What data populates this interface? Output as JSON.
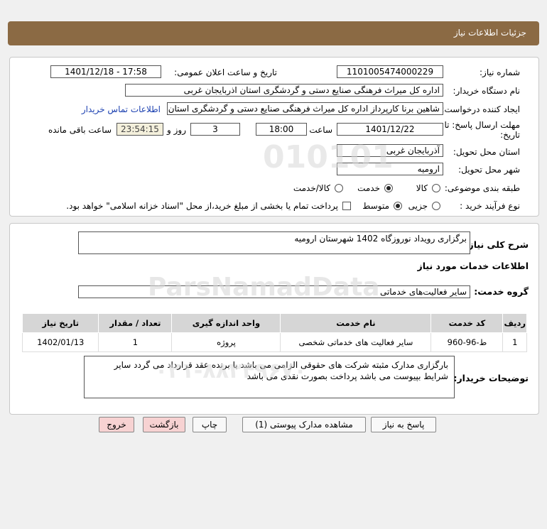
{
  "header": {
    "title": "جزئیات اطلاعات نیاز"
  },
  "form": {
    "need_number_label": "شماره نیاز:",
    "need_number": "1101005474000229",
    "announce_label": "تاریخ و ساعت اعلان عمومی:",
    "announce_value": "1401/12/18 - 17:58",
    "buyer_org_label": "نام دستگاه خریدار:",
    "buyer_org": "اداره کل میراث فرهنگی  صنایع دستی و گردشگری استان اذربایجان غربی",
    "requester_label": "ایجاد کننده درخواست:",
    "requester": "شاهین برنا کارپرداز اداره کل میراث فرهنگی  صنایع دستی و گردشگری استان اذربایجان غربی",
    "contact_link": "اطلاعات تماس خریدار",
    "deadline_label_1": "مهلت ارسال پاسخ: تا",
    "deadline_label_2": "تاریخ:",
    "deadline_date": "1401/12/22",
    "time_label": "ساعت",
    "deadline_time": "18:00",
    "days_value": "3",
    "days_label": "روز و",
    "remaining_time": "23:54:15",
    "remaining_label": "ساعت باقی مانده",
    "province_label": "استان محل تحویل:",
    "province": "آذربایجان غربی",
    "city_label": "شهر محل تحویل:",
    "city": "ارومیه",
    "category_label": "طبقه بندی موضوعی:",
    "category_options": [
      "کالا",
      "خدمت",
      "کالا/خدمت"
    ],
    "category_selected": 1,
    "process_label": "نوع فرآیند خرید :",
    "process_options": [
      "جزیی",
      "متوسط"
    ],
    "process_selected": 1,
    "payment_note": "پرداخت تمام یا بخشی از مبلغ خرید،از محل \"اسناد خزانه اسلامی\" خواهد بود."
  },
  "summary": {
    "label": "شرح کلی نیاز:",
    "value": "برگزاری رویداد نوروزگاه 1402 شهرستان ارومیه"
  },
  "services": {
    "section_title": "اطلاعات خدمات مورد نیاز",
    "group_label": "گروه خدمت:",
    "group_value": "سایر فعالیت‌های خدماتی",
    "table": {
      "headers": [
        "ردیف",
        "کد خدمت",
        "نام خدمت",
        "واحد اندازه گیری",
        "تعداد / مقدار",
        "تاریخ نیاز"
      ],
      "rows": [
        [
          "1",
          "ط-96-960",
          "سایر فعالیت های خدماتی شخصی",
          "پروژه",
          "1",
          "1402/01/13"
        ]
      ]
    }
  },
  "buyer_notes": {
    "label": "توضیحات خریدار:",
    "value": "بارگزاری مدارک مثبته شرکت های حقوقی الزامی می باشد با برنده عقد قرارداد می گردد سایر شرایط بپیوست می باشد پرداخت بصورت نقدی می باشد"
  },
  "buttons": {
    "reply": "پاسخ به نیاز",
    "attachments": "مشاهده مدارک پیوستی (1)",
    "print": "چاپ",
    "back": "بازگشت",
    "exit": "خروج"
  },
  "watermark": {
    "number": "010101",
    "brand": "ParsNamadData",
    "phone": "۰۲۱-۸۸۳۴۹۶۷۰"
  },
  "colors": {
    "header_bg": "#8b6a44",
    "link": "#1a3fb0",
    "button_pink": "#f7d2d2",
    "time_box": "#f4f0dc"
  }
}
